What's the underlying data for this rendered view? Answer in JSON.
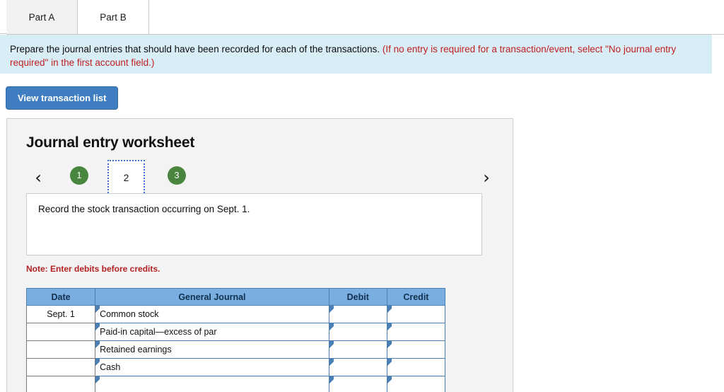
{
  "tabs": [
    {
      "label": "Part A",
      "active": false
    },
    {
      "label": "Part B",
      "active": true
    }
  ],
  "instruction": {
    "black_text": "Prepare the journal entries that should have been recorded for each of the transactions.",
    "red_text": "(If no entry is required for a transaction/event, select \"No journal entry required\" in the first account field.)"
  },
  "toolbar": {
    "view_transaction_list_label": "View transaction list"
  },
  "worksheet": {
    "title": "Journal entry worksheet",
    "pager": {
      "prev_icon": "‹",
      "next_icon": "›",
      "steps": [
        {
          "label": "1",
          "active": false
        },
        {
          "label": "2",
          "active": true
        },
        {
          "label": "3",
          "active": false
        }
      ]
    },
    "prompt": "Record the stock transaction occurring on Sept. 1.",
    "note": "Note: Enter debits before credits.",
    "table": {
      "headers": [
        "Date",
        "General Journal",
        "Debit",
        "Credit"
      ],
      "rows": [
        {
          "date": "Sept. 1",
          "account": "Common stock",
          "debit": "",
          "credit": ""
        },
        {
          "date": "",
          "account": "Paid-in capital—excess of par",
          "debit": "",
          "credit": ""
        },
        {
          "date": "",
          "account": "Retained earnings",
          "debit": "",
          "credit": ""
        },
        {
          "date": "",
          "account": "Cash",
          "debit": "",
          "credit": ""
        },
        {
          "date": "",
          "account": "",
          "debit": "",
          "credit": ""
        }
      ]
    }
  },
  "colors": {
    "banner_bg": "#d9edf7",
    "banner_red": "#c02020",
    "button_blue": "#3f7fc1",
    "step_green": "#4a8540",
    "table_header_blue": "#7aaee0",
    "input_border_blue": "#4a7fb5",
    "note_red": "#b32222"
  }
}
